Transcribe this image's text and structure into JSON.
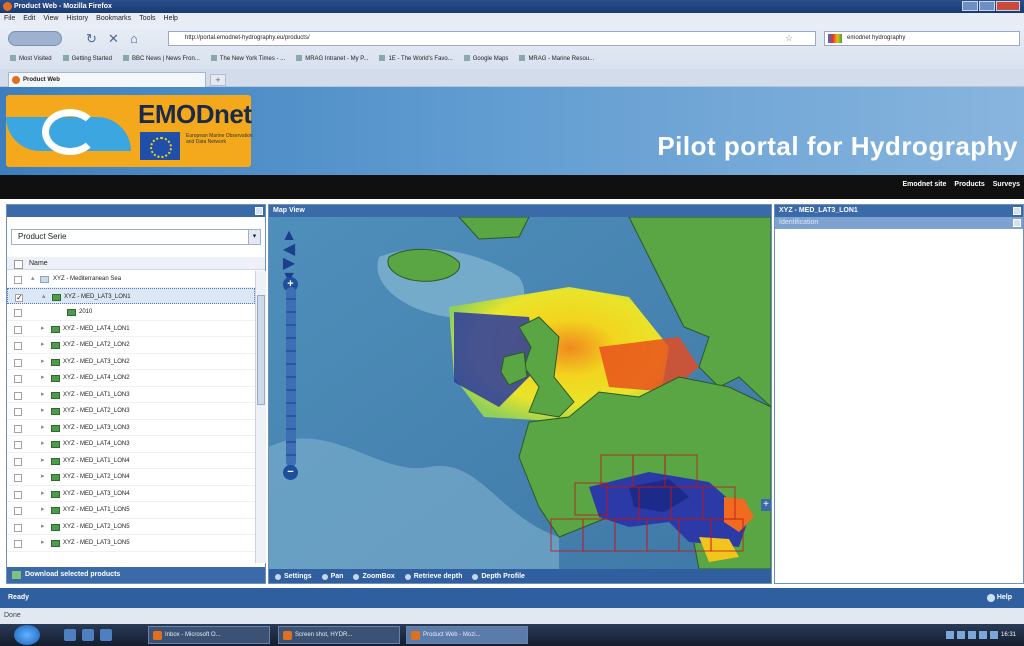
{
  "window": {
    "title": "Product Web - Mozilla Firefox"
  },
  "menu": [
    "File",
    "Edit",
    "View",
    "History",
    "Bookmarks",
    "Tools",
    "Help"
  ],
  "nav": {
    "back_label": "",
    "url": "http://portal.emodnet-hydrography.eu/products/",
    "search_value": "emodnet hydrography"
  },
  "bookmarks": [
    "Most Visited",
    "Getting Started",
    "BBC News | News Fron...",
    "The New York Times - ...",
    "MRAG Intranet - My P...",
    "1E - The World's Favo...",
    "Google Maps",
    "MRAG - Marine Resou..."
  ],
  "tab": {
    "label": "Product Web",
    "new_tab": "+"
  },
  "header": {
    "logo": "EMODnet",
    "logo_sub": "European Marine Observation and Data Network",
    "tagline": "Pilot portal for Hydrography"
  },
  "sitenav": [
    "Emodnet site",
    "Products",
    "Surveys"
  ],
  "left": {
    "dropdown": "Product Serie",
    "column": "Name",
    "rows": [
      {
        "label": "XYZ - Mediterranean Sea",
        "level": 0,
        "checked": false,
        "twisty": "▴"
      },
      {
        "label": "XYZ - MED_LAT3_LON1",
        "level": 1,
        "checked": true,
        "twisty": "▴",
        "selected": true
      },
      {
        "label": "2010",
        "level": 2,
        "checked": false,
        "twisty": ""
      },
      {
        "label": "XYZ - MED_LAT4_LON1",
        "level": 1,
        "checked": false,
        "twisty": "▸"
      },
      {
        "label": "XYZ - MED_LAT2_LON2",
        "level": 1,
        "checked": false,
        "twisty": "▸"
      },
      {
        "label": "XYZ - MED_LAT3_LON2",
        "level": 1,
        "checked": false,
        "twisty": "▸"
      },
      {
        "label": "XYZ - MED_LAT4_LON2",
        "level": 1,
        "checked": false,
        "twisty": "▸"
      },
      {
        "label": "XYZ - MED_LAT1_LON3",
        "level": 1,
        "checked": false,
        "twisty": "▸"
      },
      {
        "label": "XYZ - MED_LAT2_LON3",
        "level": 1,
        "checked": false,
        "twisty": "▸"
      },
      {
        "label": "XYZ - MED_LAT3_LON3",
        "level": 1,
        "checked": false,
        "twisty": "▸"
      },
      {
        "label": "XYZ - MED_LAT4_LON3",
        "level": 1,
        "checked": false,
        "twisty": "▸"
      },
      {
        "label": "XYZ - MED_LAT1_LON4",
        "level": 1,
        "checked": false,
        "twisty": "▸"
      },
      {
        "label": "XYZ - MED_LAT2_LON4",
        "level": 1,
        "checked": false,
        "twisty": "▸"
      },
      {
        "label": "XYZ - MED_LAT3_LON4",
        "level": 1,
        "checked": false,
        "twisty": "▸"
      },
      {
        "label": "XYZ - MED_LAT1_LON5",
        "level": 1,
        "checked": false,
        "twisty": "▸"
      },
      {
        "label": "XYZ - MED_LAT2_LON5",
        "level": 1,
        "checked": false,
        "twisty": "▸"
      },
      {
        "label": "XYZ - MED_LAT3_LON5",
        "level": 1,
        "checked": false,
        "twisty": "▸"
      }
    ],
    "download": "Download selected products"
  },
  "map": {
    "title": "Map View",
    "toolbar": [
      "Settings",
      "Pan",
      "ZoomBox",
      "Retrieve depth",
      "Depth Profile"
    ],
    "expand": "+"
  },
  "right": {
    "title": "XYZ - MED_LAT3_LON1",
    "sub": "Identification"
  },
  "status": {
    "text": "Ready",
    "help": "Help",
    "firefox": "Done"
  },
  "taskbar": {
    "tasks": [
      "Inbox - Microsoft O...",
      "Screen shot, HYDR...",
      "Product Web - Mozi..."
    ],
    "clock": "16:31"
  },
  "colors": {
    "panel_header": "#3b6aa8",
    "status_blue": "#2f5f9f",
    "logo_orange": "#f4a91c",
    "land": "#5aa544",
    "deep_sea": "#5d9cc0"
  }
}
